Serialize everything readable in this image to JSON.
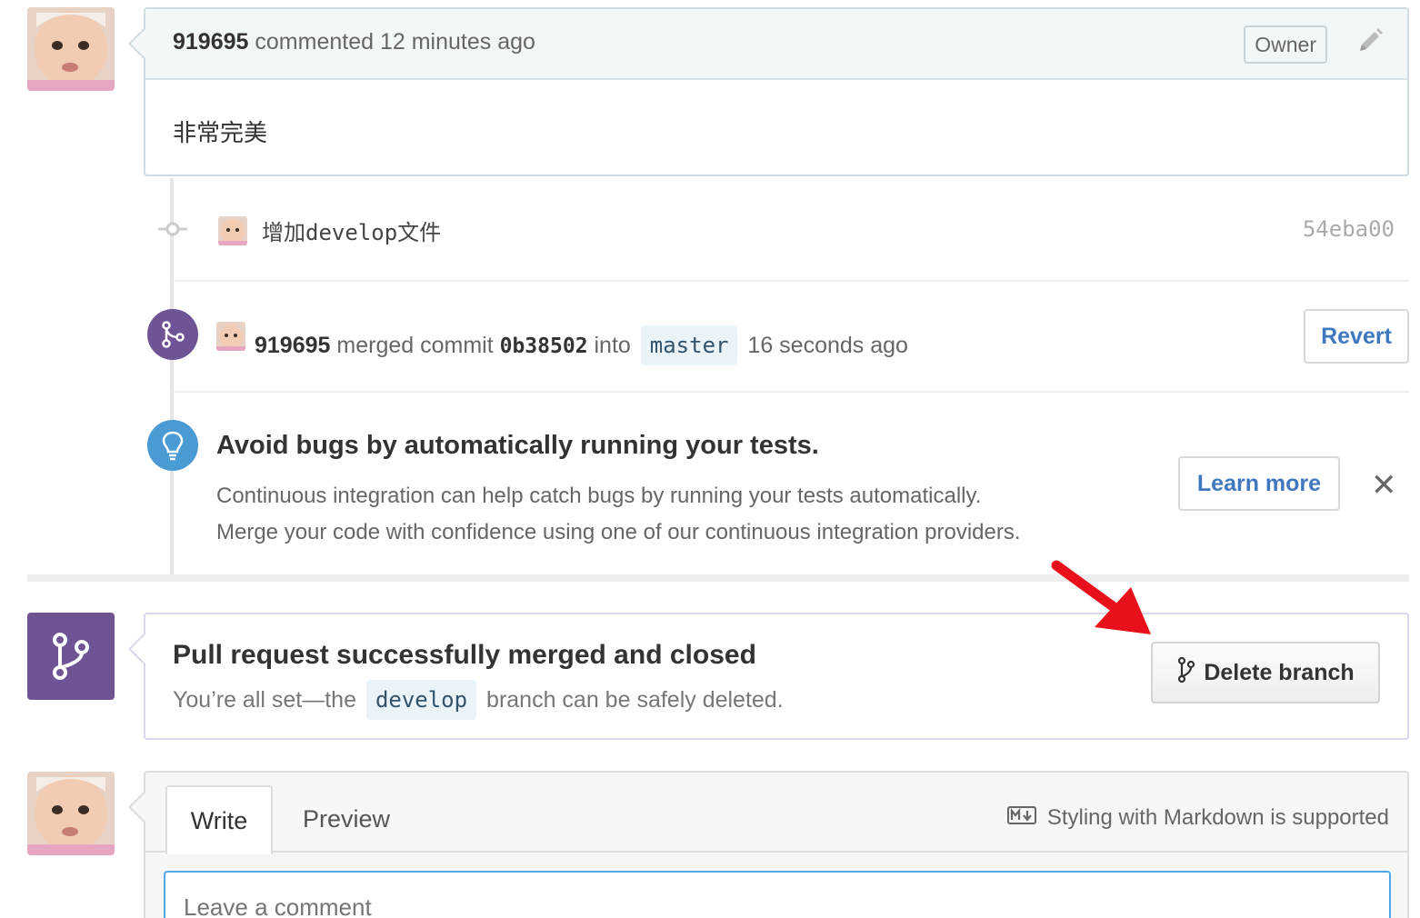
{
  "comment": {
    "author": "919695",
    "action": "commented 12 minutes ago",
    "badge": "Owner",
    "body": "非常完美"
  },
  "commit": {
    "message": "增加develop文件",
    "sha": "54eba00"
  },
  "merge_event": {
    "author": "919695",
    "verb": "merged commit",
    "sha": "0b38502",
    "into": "into",
    "branch": "master",
    "time": "16 seconds ago",
    "revert_label": "Revert"
  },
  "ci_promo": {
    "title": "Avoid bugs by automatically running your tests.",
    "line1": "Continuous integration can help catch bugs by running your tests automatically.",
    "line2": "Merge your code with confidence using one of our continuous integration providers.",
    "learn_more_label": "Learn more",
    "close_label": "✕"
  },
  "merge_status": {
    "title": "Pull request successfully merged and closed",
    "desc_prefix": "You’re all set—the",
    "branch": "develop",
    "desc_suffix": "branch can be safely deleted.",
    "delete_label": "Delete branch"
  },
  "composer": {
    "tab_write": "Write",
    "tab_preview": "Preview",
    "markdown_note": "Styling with Markdown is supported",
    "placeholder": "Leave a comment"
  },
  "colors": {
    "merge_purple": "#6e5494",
    "info_blue": "#4a9ad4",
    "link_blue": "#4078c0",
    "arrow_red": "#e8101a"
  }
}
